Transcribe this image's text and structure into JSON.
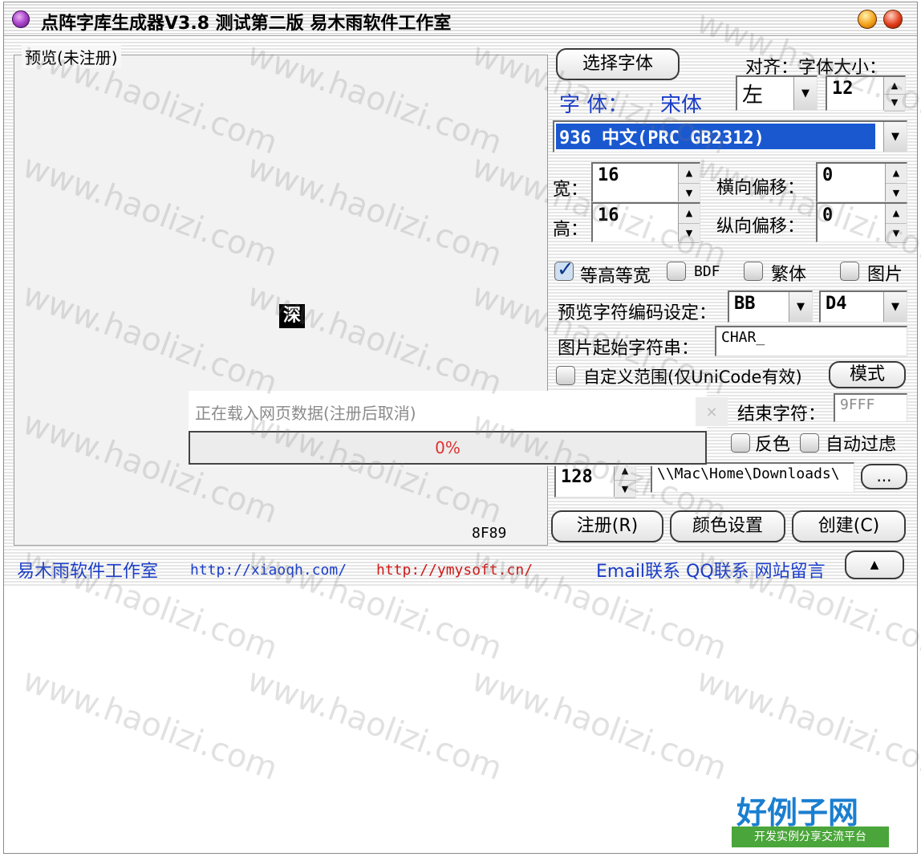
{
  "window": {
    "title": "点阵字库生成器V3.8 测试第二版 易木雨软件工作室"
  },
  "preview": {
    "group_label": "预览(未注册)",
    "glyph": "深",
    "code": "8F89"
  },
  "font_panel": {
    "select_font_button": "选择字体",
    "align_size_label": "对齐：字体大小：",
    "font_label": "字  体：",
    "font_name": "宋体",
    "align_value": "左",
    "size_value": "12",
    "charset_value": "936 中文(PRC GB2312)"
  },
  "metrics": {
    "width_label": "宽：",
    "width_value": "16",
    "height_label": "高：",
    "height_value": "16",
    "hoffset_label": "横向偏移：",
    "hoffset_value": "0",
    "voffset_label": "纵向偏移：",
    "voffset_value": "0"
  },
  "options": {
    "equal_label": "等高等宽",
    "equal_checked": true,
    "bdf_label": "BDF",
    "traditional_label": "繁体",
    "image_label": "图片"
  },
  "encoding": {
    "label": "预览字符编码设定：",
    "byte1": "BB",
    "byte2": "D4",
    "image_prefix_label": "图片起始字符串：",
    "image_prefix_value": "CHAR_",
    "custom_range_label": "自定义范围(仅UniCode有效)",
    "mode_button": "模式",
    "end_char_label": "结束字符：",
    "end_char_value": "9FFF",
    "invert_label": "反色",
    "autofilter_label": "自动过虑",
    "count_value": "128",
    "path_value": "\\\\Mac\\Home\\Downloads\\",
    "browse_button": "..."
  },
  "actions": {
    "register": "注册(R)",
    "color": "颜色设置",
    "create": "创建(C)"
  },
  "footer": {
    "studio": "易木雨软件工作室",
    "url1": "http://xiaoqh.com/",
    "url2": "http://ymysoft.cn/",
    "contact": "Email联系 QQ联系 网站留言",
    "up_button": "▲"
  },
  "overlay": {
    "message": "正在载入网页数据(注册后取消)",
    "close": "×",
    "progress": "0%"
  },
  "watermark": {
    "text": "www.haolizi.com",
    "logo_main": "好例子网",
    "logo_sub": "开发实例分享交流平台"
  }
}
